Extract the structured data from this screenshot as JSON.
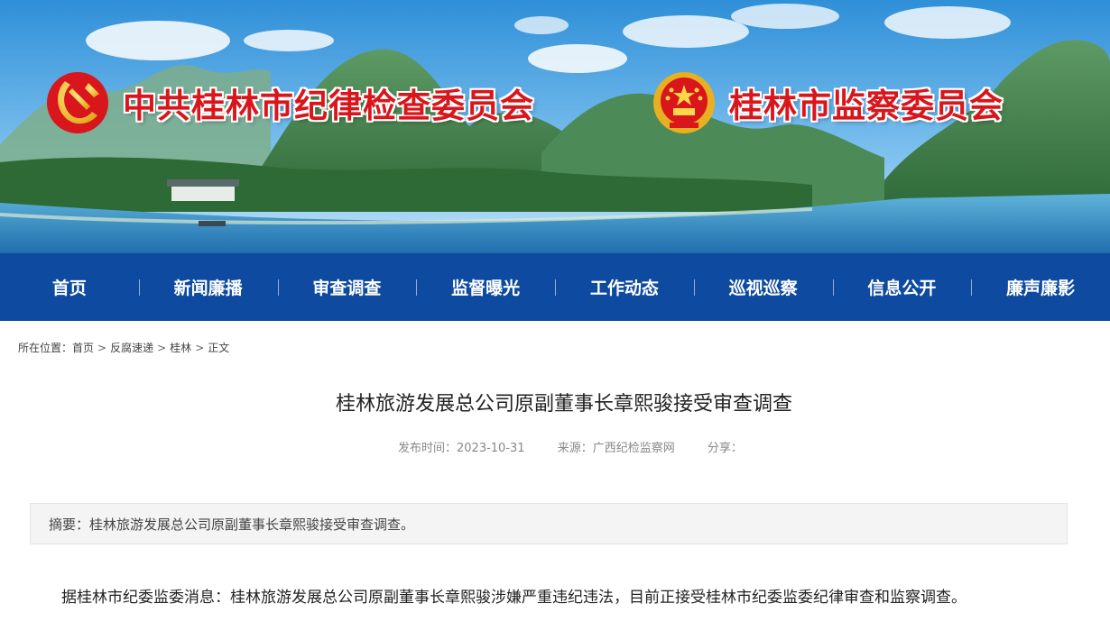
{
  "banner": {
    "left_org_title": "中共桂林市纪律检查委员会",
    "right_org_title": "桂林市监察委员会"
  },
  "nav": {
    "items": [
      {
        "label": "首页"
      },
      {
        "label": "新闻廉播"
      },
      {
        "label": "审查调查"
      },
      {
        "label": "监督曝光"
      },
      {
        "label": "工作动态"
      },
      {
        "label": "巡视巡察"
      },
      {
        "label": "信息公开"
      },
      {
        "label": "廉声廉影"
      }
    ]
  },
  "breadcrumb": {
    "prefix": "所在位置：",
    "items": [
      "首页",
      "反腐速递",
      "桂林",
      "正文"
    ],
    "separator": ">"
  },
  "article": {
    "title": "桂林旅游发展总公司原副董事长章熙骏接受审查调查",
    "publish_time": "发布时间：2023-10-31",
    "source": "来源：广西纪检监察网",
    "share": "分享：",
    "summary": "摘要：桂林旅游发展总公司原副董事长章熙骏接受审查调查。",
    "body": "据桂林市纪委监委消息：桂林旅游发展总公司原副董事长章熙骏涉嫌严重违纪违法，目前正接受桂林市纪委监委纪律审查和监察调查。"
  },
  "colors": {
    "nav_bg": "#0d4aa0",
    "org_title": "#d8161c",
    "summary_bg": "#f4f4f4"
  }
}
